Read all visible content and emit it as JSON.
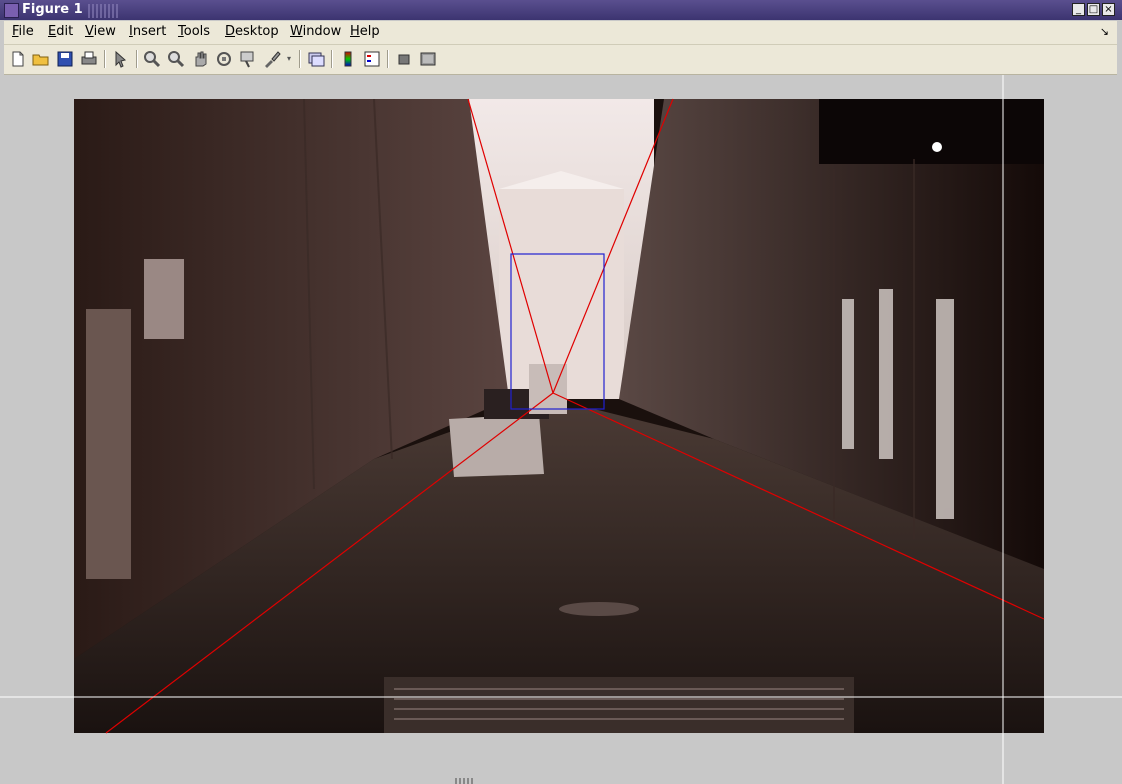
{
  "window": {
    "title": "Figure 1",
    "minimize": "_",
    "maximize": "□",
    "close": "×"
  },
  "menu": {
    "items": [
      {
        "label": "File"
      },
      {
        "label": "Edit"
      },
      {
        "label": "View"
      },
      {
        "label": "Insert"
      },
      {
        "label": "Tools"
      },
      {
        "label": "Desktop"
      },
      {
        "label": "Window"
      },
      {
        "label": "Help"
      }
    ],
    "dock_arrow": "↘"
  },
  "toolbar": {
    "icons": [
      "new-figure-icon",
      "open-file-icon",
      "save-icon",
      "print-icon",
      "select-arrow-icon",
      "zoom-in-icon",
      "zoom-out-icon",
      "pan-hand-icon",
      "rotate-3d-icon",
      "data-cursor-icon",
      "brush-icon",
      "link-icon",
      "colorbar-icon",
      "legend-icon",
      "hide-plot-tools-icon",
      "show-plot-tools-icon"
    ]
  },
  "colors": {
    "vanishing_lines": "#e00000",
    "roi_box": "#2020d0",
    "crosshair": "#ffffff"
  }
}
